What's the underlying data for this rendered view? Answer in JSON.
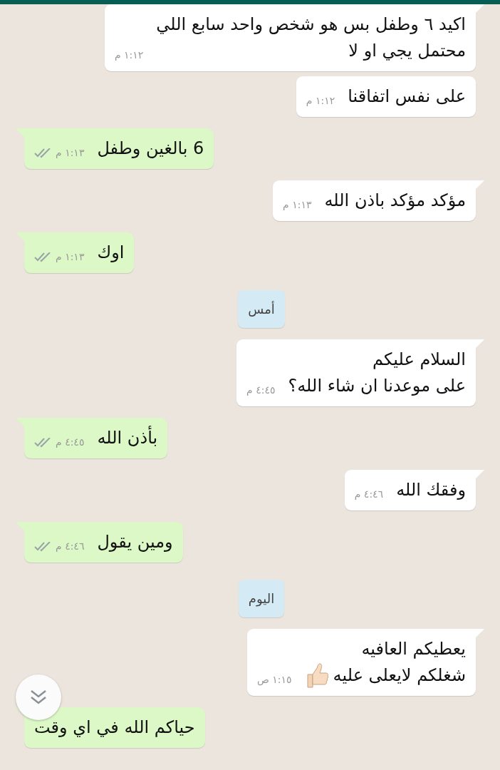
{
  "messages": [
    {
      "kind": "incoming",
      "tail": true,
      "text": "اكيد ٦ وطفل بس هو شخص واحد سابع اللي\nمحتمل يجي او لا",
      "time": "١:١٢ م"
    },
    {
      "kind": "incoming",
      "tail": false,
      "text": "على نفس اتفاقنا",
      "time": "١:١٢ م"
    },
    {
      "kind": "outgoing",
      "tail": true,
      "text": "6 بالغين وطفل",
      "time": "١:١٣ م",
      "read": false
    },
    {
      "kind": "incoming",
      "tail": true,
      "text": "مؤكد مؤكد باذن الله",
      "time": "١:١٣ م"
    },
    {
      "kind": "outgoing",
      "tail": true,
      "text": "اوك",
      "time": "١:١٣ م",
      "read": false
    },
    {
      "kind": "date",
      "text": "أمس"
    },
    {
      "kind": "incoming",
      "tail": true,
      "text": "السلام عليكم\nعلى موعدنا ان شاء الله؟",
      "time": "٤:٤٥ م"
    },
    {
      "kind": "outgoing",
      "tail": true,
      "text": "بأذن الله",
      "time": "٤:٤٥ م",
      "read": false
    },
    {
      "kind": "incoming",
      "tail": true,
      "text": "وفقك الله",
      "time": "٤:٤٦ م"
    },
    {
      "kind": "outgoing",
      "tail": true,
      "text": "ومين يقول",
      "time": "٤:٤٦ م",
      "read": false
    },
    {
      "kind": "date",
      "text": "اليوم"
    },
    {
      "kind": "incoming",
      "tail": true,
      "text": "يعطيكم العافيه\nشغلكم لايعلى عليه",
      "time": "١:١٥ ص",
      "thumbs_up": true
    },
    {
      "kind": "outgoing",
      "tail": true,
      "text": "حياكم الله في اي وقت"
    }
  ]
}
